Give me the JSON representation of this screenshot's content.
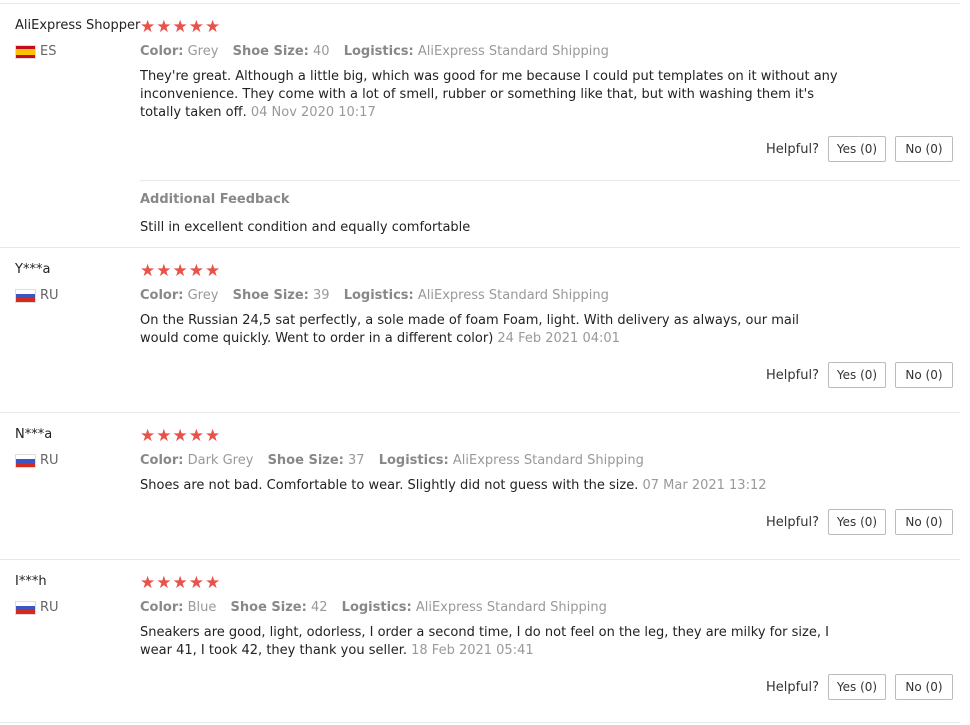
{
  "helpful_label": "Helpful?",
  "reviews": [
    {
      "user": "AliExpress Shopper",
      "country": "ES",
      "stars": "★★★★★",
      "color_label": "Color:",
      "color": "Grey",
      "size_label": "Shoe Size:",
      "size": "40",
      "logistics_label": "Logistics:",
      "logistics": "AliExpress Standard Shipping",
      "text": "They're great. Although a little big, which was good for me because I could put templates on it without any inconvenience. They come with a lot of smell, rubber or something like that, but with washing them it's totally taken off.",
      "date": "04 Nov 2020 10:17",
      "yes": "Yes (0)",
      "no": "No (0)",
      "additional_title": "Additional Feedback",
      "additional_text": "Still in excellent condition and equally comfortable"
    },
    {
      "user": "Y***a",
      "country": "RU",
      "stars": "★★★★★",
      "color_label": "Color:",
      "color": "Grey",
      "size_label": "Shoe Size:",
      "size": "39",
      "logistics_label": "Logistics:",
      "logistics": "AliExpress Standard Shipping",
      "text": "On the Russian 24,5 sat perfectly, a sole made of foam Foam, light. With delivery as always, our mail would come quickly. Went to order in a different color)",
      "date": "24 Feb 2021 04:01",
      "yes": "Yes (0)",
      "no": "No (0)"
    },
    {
      "user": "N***a",
      "country": "RU",
      "stars": "★★★★★",
      "color_label": "Color:",
      "color": "Dark Grey",
      "size_label": "Shoe Size:",
      "size": "37",
      "logistics_label": "Logistics:",
      "logistics": "AliExpress Standard Shipping",
      "text": "Shoes are not bad. Comfortable to wear. Slightly did not guess with the size.",
      "date": "07 Mar 2021 13:12",
      "yes": "Yes (0)",
      "no": "No (0)"
    },
    {
      "user": "I***h",
      "country": "RU",
      "stars": "★★★★★",
      "color_label": "Color:",
      "color": "Blue",
      "size_label": "Shoe Size:",
      "size": "42",
      "logistics_label": "Logistics:",
      "logistics": "AliExpress Standard Shipping",
      "text": "Sneakers are good, light, odorless, I order a second time, I do not feel on the leg, they are milky for size, I wear 41, I took 42, they thank you seller.",
      "date": "18 Feb 2021 05:41",
      "yes": "Yes (0)",
      "no": "No (0)"
    }
  ]
}
